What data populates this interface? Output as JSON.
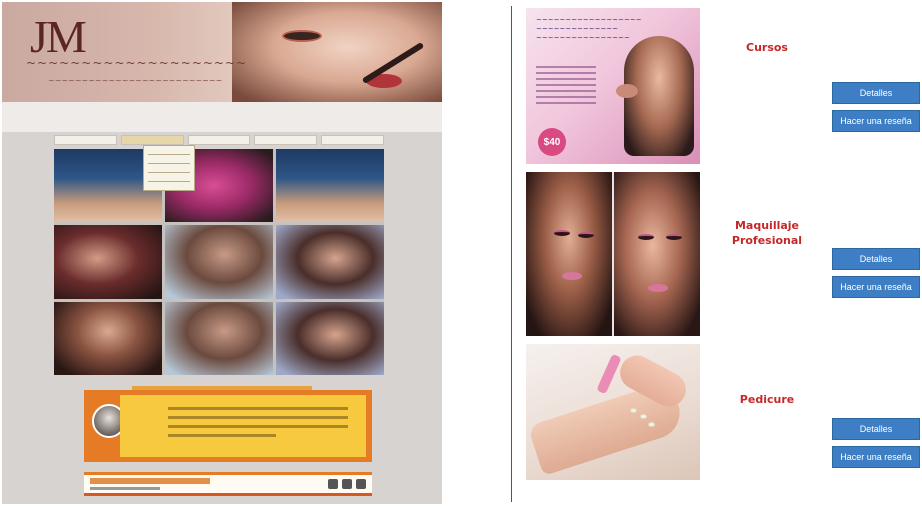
{
  "left_site": {
    "logo_text": "JM",
    "testimonial_price_hint": ""
  },
  "products": [
    {
      "title": "Cursos",
      "price": "$40",
      "details_label": "Detalles",
      "review_label": "Hacer una reseña"
    },
    {
      "title": "Maquillaje Profesional",
      "details_label": "Detalles",
      "review_label": "Hacer una reseña"
    },
    {
      "title": "Pedicure",
      "details_label": "Detalles",
      "review_label": "Hacer una reseña"
    }
  ],
  "colors": {
    "title_red": "#c62828",
    "button_blue": "#3e7ec4",
    "testimonial_orange": "#e57b25",
    "testimonial_yellow": "#f6c93e"
  }
}
